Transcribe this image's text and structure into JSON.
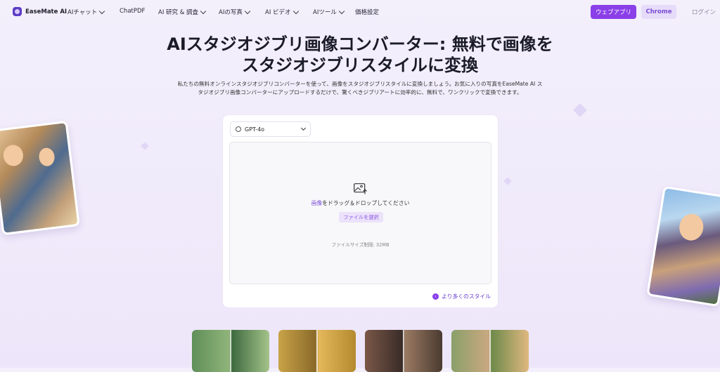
{
  "nav": {
    "logo_text": "EaseMate AI",
    "items": [
      "AIチャット",
      "ChatPDF",
      "AI 研究 & 調査",
      "AIの写真",
      "AI ビデオ",
      "AIツール",
      "価格設定"
    ],
    "app_button": "ウェブアプリ",
    "chrome_button": "Chrome",
    "login": "ログイン"
  },
  "hero": {
    "title_line1": "AIスタジオジブリ画像コンバーター: 無料で画像を",
    "title_line2": "スタジオジブリスタイルに変換",
    "desc_line1": "私たちの無料オンラインスタジオジブリコンバーターを使って、画像をスタジオジブリスタイルに変換しましょう。お気に入りの写真をEaseMate AI ス",
    "desc_line2": "タジオジブリ画像コンバーターにアップロードするだけで、驚くべきジブリアートに効率的に、無料で、ワンクリックで変換できます。"
  },
  "converter": {
    "model": "GPT-4o",
    "drop_highlight": "画像",
    "drop_rest": "をドラッグ＆ドロップしてください",
    "file_button": "ファイルを選択",
    "size_limit": "ファイルサイズ制限: 32MB",
    "more_styles": "より多くのスタイル"
  },
  "colors": {
    "accent": "#8a3fe8",
    "chrome_bg": "#e6dcf9",
    "background": "#f1ecfb"
  }
}
